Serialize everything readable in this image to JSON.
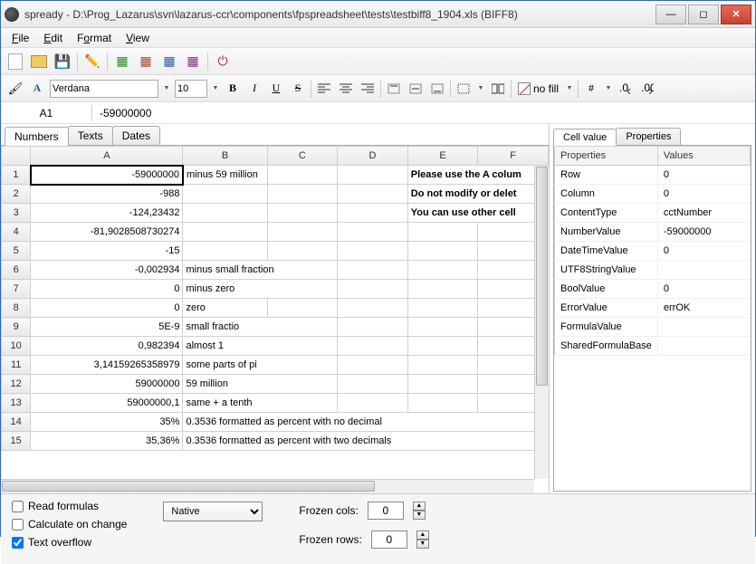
{
  "window": {
    "title": "spready - D:\\Prog_Lazarus\\svn\\lazarus-ccr\\components\\fpspreadsheet\\tests\\testbiff8_1904.xls (BIFF8)"
  },
  "menu": {
    "file": "File",
    "edit": "Edit",
    "format": "Format",
    "view": "View"
  },
  "font": {
    "name": "Verdana",
    "size": "10",
    "bold": "B",
    "italic": "I",
    "underline": "U",
    "strike": "S",
    "nofill": "no fill",
    "hash": "#"
  },
  "cellref": {
    "addr": "A1",
    "value": "-59000000"
  },
  "tabs": {
    "numbers": "Numbers",
    "texts": "Texts",
    "dates": "Dates"
  },
  "cols": {
    "A": "A",
    "B": "B",
    "C": "C",
    "D": "D",
    "E": "E",
    "F": "F"
  },
  "rows": {
    "1": {
      "n": "1",
      "a": "-59000000",
      "b": "minus 59 million",
      "e": "Please use the A colum"
    },
    "2": {
      "n": "2",
      "a": "-988",
      "e": "Do not modify or delet"
    },
    "3": {
      "n": "3",
      "a": "-124,23432",
      "e": "You can use other cell"
    },
    "4": {
      "n": "4",
      "a": "-81,9028508730274"
    },
    "5": {
      "n": "5",
      "a": "-15"
    },
    "6": {
      "n": "6",
      "a": "-0,002934",
      "b": "minus small fraction"
    },
    "7": {
      "n": "7",
      "a": "0",
      "b": "minus zero"
    },
    "8": {
      "n": "8",
      "a": "0",
      "b": "zero"
    },
    "9": {
      "n": "9",
      "a": "5E-9",
      "b": "small fractio"
    },
    "10": {
      "n": "10",
      "a": "0,982394",
      "b": "almost 1"
    },
    "11": {
      "n": "11",
      "a": "3,14159265358979",
      "b": "some parts of pi"
    },
    "12": {
      "n": "12",
      "a": "59000000",
      "b": "59 million"
    },
    "13": {
      "n": "13",
      "a": "59000000,1",
      "b": "same + a tenth"
    },
    "14": {
      "n": "14",
      "a": "35%",
      "b": "0.3536 formatted as percent with no decimal"
    },
    "15": {
      "n": "15",
      "a": "35,36%",
      "b": "0.3536 formatted as percent with two decimals"
    }
  },
  "rtabs": {
    "cellvalue": "Cell value",
    "properties": "Properties"
  },
  "props": {
    "h1": "Properties",
    "h2": "Values",
    "row": "Row",
    "row_v": "0",
    "col": "Column",
    "col_v": "0",
    "ct": "ContentType",
    "ct_v": "cctNumber",
    "nv": "NumberValue",
    "nv_v": "-59000000",
    "dt": "DateTimeValue",
    "dt_v": "0",
    "u8": "UTF8StringValue",
    "u8_v": "",
    "bv": "BoolValue",
    "bv_v": "0",
    "ev": "ErrorValue",
    "ev_v": "errOK",
    "fv": "FormulaValue",
    "fv_v": "",
    "sf": "SharedFormulaBase",
    "sf_v": ""
  },
  "bottom": {
    "readf": "Read formulas",
    "calc": "Calculate on change",
    "tover": "Text overflow",
    "native": "Native",
    "fcols": "Frozen cols:",
    "frows": "Frozen rows:",
    "fcols_v": "0",
    "frows_v": "0"
  }
}
